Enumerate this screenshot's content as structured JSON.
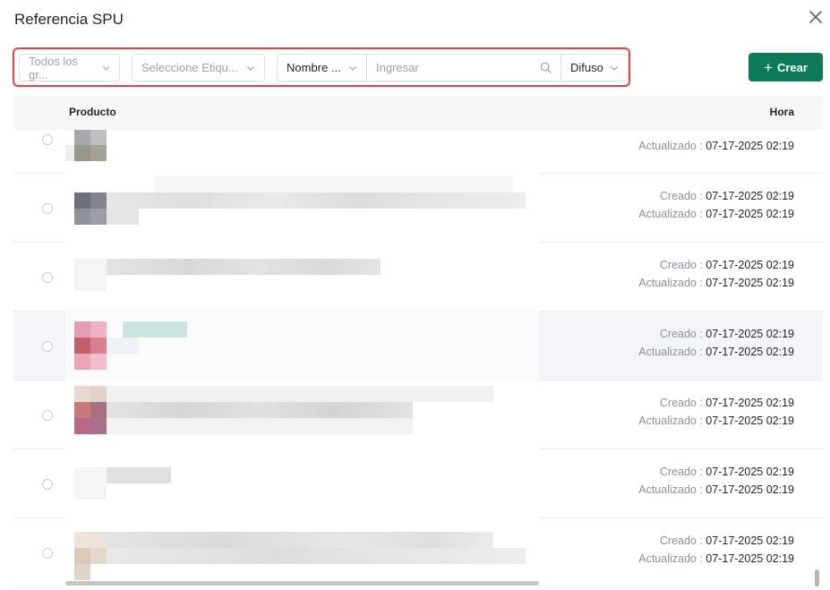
{
  "dialog": {
    "title": "Referencia SPU"
  },
  "icons": {
    "close": "close-icon",
    "chevron": "chevron-down-icon",
    "search": "search-icon",
    "plus": "plus-icon"
  },
  "filters": {
    "group": "Todos los gr...",
    "tag": "Seleccione Etiqu...",
    "field": "Nombre ...",
    "search_placeholder": "Ingresar",
    "match": "Difuso"
  },
  "actions": {
    "create_label": "Crear",
    "create_plus": "+"
  },
  "colors": {
    "accent": "#0e7a5c",
    "highlight_border": "#e9413c"
  },
  "table": {
    "columns": {
      "product": "Producto",
      "time": "Hora"
    },
    "created_label": "Creado",
    "updated_label": "Actualizado",
    "separator": " : ",
    "rows": [
      {
        "created": "",
        "updated": "07-17-2025 02:19"
      },
      {
        "created": "07-17-2025 02:19",
        "updated": "07-17-2025 02:19"
      },
      {
        "created": "07-17-2025 02:19",
        "updated": "07-17-2025 02:19"
      },
      {
        "created": "07-17-2025 02:19",
        "updated": "07-17-2025 02:19"
      },
      {
        "created": "07-17-2025 02:19",
        "updated": "07-17-2025 02:19"
      },
      {
        "created": "07-17-2025 02:19",
        "updated": "07-17-2025 02:19"
      },
      {
        "created": "07-17-2025 02:19",
        "updated": "07-17-2025 02:19"
      }
    ]
  }
}
